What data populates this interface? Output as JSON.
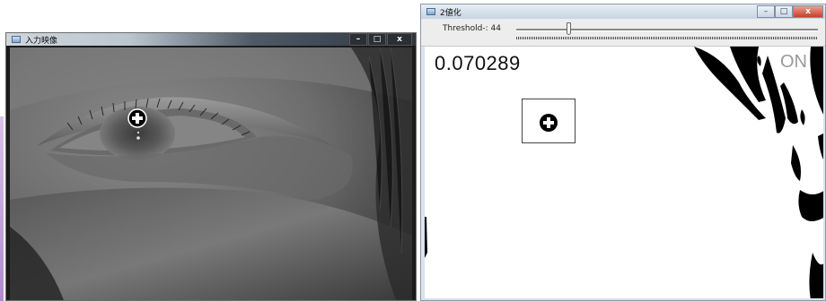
{
  "windows": {
    "input": {
      "title": "入力映像",
      "buttons": {
        "minimize": "–",
        "maximize": "□",
        "close": "x"
      }
    },
    "binary": {
      "title": "2値化",
      "buttons": {
        "minimize": "–",
        "maximize": "□",
        "close": "x"
      },
      "trackbar": {
        "label": "Threshold-: 44",
        "value": 44
      },
      "value_text": "0.070289",
      "overlay_text": "ON"
    }
  },
  "icons": {
    "eye_marker": "crosshair-plus-icon",
    "binary_marker": "crosshair-plus-icon",
    "window_icon": "app-window-icon"
  },
  "colors": {
    "binary_background": "#ffffff",
    "binary_foreground": "#000000",
    "desktop_accent": "#b08ad0"
  }
}
